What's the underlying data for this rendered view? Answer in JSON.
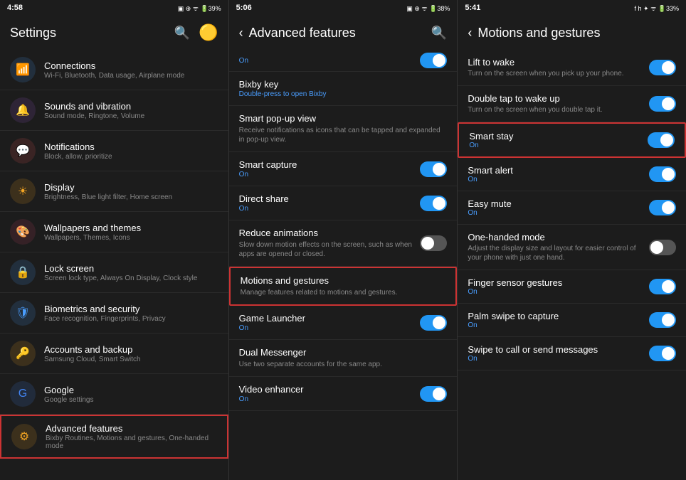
{
  "panel1": {
    "statusbar": {
      "time": "4:58",
      "icons": "▣ ✦ 📶 🔋39%"
    },
    "header": {
      "title": "Settings",
      "searchLabel": "🔍",
      "avatarLabel": "👤"
    },
    "items": [
      {
        "id": "connections",
        "icon": "📶",
        "iconClass": "icon-wifi icon-circle-wifi",
        "title": "Connections",
        "subtitle": "Wi-Fi, Bluetooth, Data usage, Airplane mode"
      },
      {
        "id": "sounds",
        "icon": "🔔",
        "iconClass": "icon-volume icon-circle-vol",
        "title": "Sounds and vibration",
        "subtitle": "Sound mode, Ringtone, Volume"
      },
      {
        "id": "notifications",
        "icon": "💬",
        "iconClass": "icon-notif icon-circle-notif",
        "title": "Notifications",
        "subtitle": "Block, allow, prioritize"
      },
      {
        "id": "display",
        "icon": "☀",
        "iconClass": "icon-display icon-circle-disp",
        "title": "Display",
        "subtitle": "Brightness, Blue light filter, Home screen"
      },
      {
        "id": "wallpapers",
        "icon": "🎨",
        "iconClass": "icon-wallpaper icon-circle-wall",
        "title": "Wallpapers and themes",
        "subtitle": "Wallpapers, Themes, Icons"
      },
      {
        "id": "lockscreen",
        "icon": "🔒",
        "iconClass": "icon-lock icon-circle-lock",
        "title": "Lock screen",
        "subtitle": "Screen lock type, Always On Display, Clock style"
      },
      {
        "id": "biometrics",
        "icon": "🛡",
        "iconClass": "icon-bio icon-circle-bio",
        "title": "Biometrics and security",
        "subtitle": "Face recognition, Fingerprints, Privacy"
      },
      {
        "id": "accounts",
        "icon": "🔑",
        "iconClass": "icon-account icon-circle-acc",
        "title": "Accounts and backup",
        "subtitle": "Samsung Cloud, Smart Switch"
      },
      {
        "id": "google",
        "icon": "G",
        "iconClass": "icon-google icon-circle-goo",
        "title": "Google",
        "subtitle": "Google settings"
      },
      {
        "id": "advanced",
        "icon": "⚙",
        "iconClass": "icon-advanced icon-circle-adv",
        "title": "Advanced features",
        "subtitle": "Bixby Routines, Motions and gestures, One-handed mode",
        "highlighted": true
      }
    ]
  },
  "panel2": {
    "statusbar": {
      "time": "5:06",
      "icons": "▣ ✦ 📶 🔋38%"
    },
    "header": {
      "title": "Advanced features",
      "searchLabel": "🔍"
    },
    "items": [
      {
        "id": "top-partial",
        "title": "",
        "statusOn": "On",
        "hasToggle": true,
        "toggleOn": true,
        "partial": true
      },
      {
        "id": "bixby-key",
        "title": "Bixby key",
        "desc": "Double-press to open Bixby",
        "hasToggle": false,
        "descIsBlue": true
      },
      {
        "id": "smart-popup",
        "title": "Smart pop-up view",
        "desc": "Receive notifications as icons that can be tapped and expanded in pop-up view.",
        "hasToggle": false
      },
      {
        "id": "smart-capture",
        "title": "Smart capture",
        "statusOn": "On",
        "hasToggle": true,
        "toggleOn": true
      },
      {
        "id": "direct-share",
        "title": "Direct share",
        "statusOn": "On",
        "hasToggle": true,
        "toggleOn": true
      },
      {
        "id": "reduce-animations",
        "title": "Reduce animations",
        "desc": "Slow down motion effects on the screen, such as when apps are opened or closed.",
        "hasToggle": true,
        "toggleOn": false
      },
      {
        "id": "motions-gestures",
        "title": "Motions and gestures",
        "desc": "Manage features related to motions and gestures.",
        "hasToggle": false,
        "highlighted": true
      },
      {
        "id": "game-launcher",
        "title": "Game Launcher",
        "statusOn": "On",
        "hasToggle": true,
        "toggleOn": true
      },
      {
        "id": "dual-messenger",
        "title": "Dual Messenger",
        "desc": "Use two separate accounts for the same app.",
        "hasToggle": false
      },
      {
        "id": "video-enhancer",
        "title": "Video enhancer",
        "statusOn": "On",
        "hasToggle": true,
        "toggleOn": true
      }
    ]
  },
  "panel3": {
    "statusbar": {
      "time": "5:41",
      "icons": "f h ✦ 📶 🔋33%"
    },
    "header": {
      "title": "Motions and gestures"
    },
    "items": [
      {
        "id": "lift-wake",
        "title": "Lift to wake",
        "desc": "Turn on the screen when you pick up your phone.",
        "hasToggle": true,
        "toggleOn": true
      },
      {
        "id": "double-tap-wake",
        "title": "Double tap to wake up",
        "desc": "Turn on the screen when you double tap it.",
        "hasToggle": true,
        "toggleOn": true
      },
      {
        "id": "smart-stay",
        "title": "Smart stay",
        "statusOn": "On",
        "hasToggle": true,
        "toggleOn": true,
        "highlighted": true
      },
      {
        "id": "smart-alert",
        "title": "Smart alert",
        "statusOn": "On",
        "hasToggle": true,
        "toggleOn": true
      },
      {
        "id": "easy-mute",
        "title": "Easy mute",
        "statusOn": "On",
        "hasToggle": true,
        "toggleOn": true
      },
      {
        "id": "one-handed",
        "title": "One-handed mode",
        "desc": "Adjust the display size and layout for easier control of your phone with just one hand.",
        "hasToggle": true,
        "toggleOn": false
      },
      {
        "id": "finger-sensor",
        "title": "Finger sensor gestures",
        "statusOn": "On",
        "hasToggle": true,
        "toggleOn": true
      },
      {
        "id": "palm-swipe",
        "title": "Palm swipe to capture",
        "statusOn": "On",
        "hasToggle": true,
        "toggleOn": true
      },
      {
        "id": "swipe-call",
        "title": "Swipe to call or send messages",
        "statusOn": "On",
        "hasToggle": true,
        "toggleOn": true
      }
    ]
  }
}
